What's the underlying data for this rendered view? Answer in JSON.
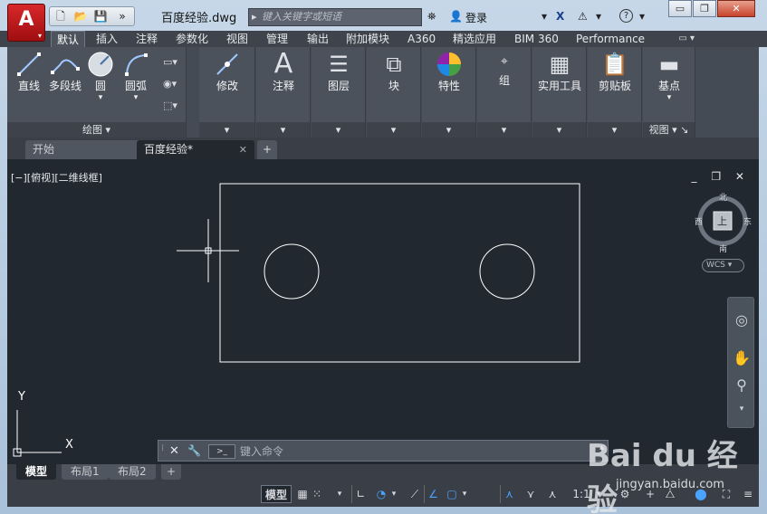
{
  "app": {
    "logo_letter": "A",
    "document_title": "百度经验.dwg"
  },
  "search": {
    "placeholder": "键入关键字或短语"
  },
  "user": {
    "login_label": "登录"
  },
  "window_controls": {
    "minimize": "▭",
    "restore": "❐",
    "close": "✕"
  },
  "ribbon_tabs": [
    {
      "label": "默认",
      "active": true
    },
    {
      "label": "插入"
    },
    {
      "label": "注释"
    },
    {
      "label": "参数化"
    },
    {
      "label": "视图"
    },
    {
      "label": "管理"
    },
    {
      "label": "输出"
    },
    {
      "label": "附加模块"
    },
    {
      "label": "A360"
    },
    {
      "label": "精选应用"
    },
    {
      "label": "BIM 360"
    },
    {
      "label": "Performance"
    }
  ],
  "draw_panel": {
    "footer": "绘图 ▾",
    "tools": [
      {
        "label": "直线",
        "icon": "line-icon"
      },
      {
        "label": "多段线",
        "icon": "polyline-icon"
      },
      {
        "label": "圆",
        "icon": "circle-icon"
      },
      {
        "label": "圆弧",
        "icon": "arc-icon"
      }
    ]
  },
  "panels": [
    {
      "label": "修改",
      "icon": "modify-icon"
    },
    {
      "label": "注释",
      "icon": "annotation-icon"
    },
    {
      "label": "图层",
      "icon": "layers-icon"
    },
    {
      "label": "块",
      "icon": "block-icon"
    },
    {
      "label": "特性",
      "icon": "properties-icon"
    },
    {
      "label": "组",
      "icon": "group-icon"
    },
    {
      "label": "实用工具",
      "icon": "utilities-icon"
    },
    {
      "label": "剪贴板",
      "icon": "clipboard-icon"
    },
    {
      "label": "基点",
      "icon": "basepoint-icon"
    }
  ],
  "view_panel": {
    "footer": "视图 ▾ ↘"
  },
  "doc_tabs": {
    "start": "开始",
    "current": "百度经验*",
    "new": "+"
  },
  "viewport": {
    "label": "[−][俯视][二维线框]",
    "controls": "_ ❐ ✕"
  },
  "viewcube": {
    "north": "北",
    "south": "南",
    "east": "东",
    "west": "西",
    "face": "上",
    "wcs": "WCS"
  },
  "ucs": {
    "x": "X",
    "y": "Y"
  },
  "command_line": {
    "placeholder": "键入命令",
    "prompt_icon": ">_"
  },
  "layout_tabs": [
    {
      "label": "模型",
      "active": true
    },
    {
      "label": "布局1"
    },
    {
      "label": "布局2"
    },
    {
      "label": "+"
    }
  ],
  "status_bar": {
    "model": "模型",
    "grid": "▦",
    "scale": "1:1"
  },
  "watermark": {
    "logo": "Bai du 经验",
    "url": "jingyan.baidu.com"
  },
  "colors": {
    "canvas": "#212830",
    "ribbon": "#454b54",
    "accent": "#4aa3ff",
    "logo_red": "#c91d1f"
  }
}
